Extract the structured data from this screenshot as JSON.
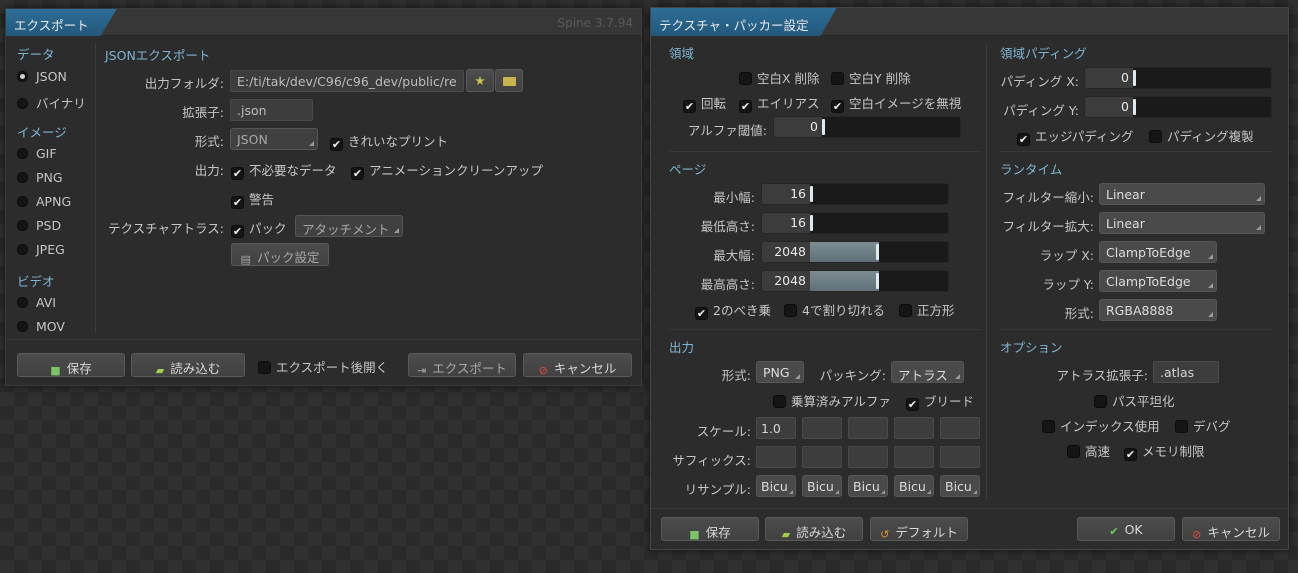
{
  "export_window": {
    "title": "エクスポート",
    "version": "Spine 3.7.94",
    "sidebar": {
      "data_header": "データ",
      "json": "JSON",
      "binary": "バイナリ",
      "image_header": "イメージ",
      "gif": "GIF",
      "png": "PNG",
      "apng": "APNG",
      "psd": "PSD",
      "jpeg": "JPEG",
      "video_header": "ビデオ",
      "avi": "AVI",
      "mov": "MOV",
      "selected": "JSON"
    },
    "main": {
      "section_title": "JSONエクスポート",
      "output_folder_label": "出力フォルダ:",
      "output_folder_value": "E:/ti/tak/dev/C96/c96_dev/public/re",
      "extension_label": "拡張子:",
      "extension_value": ".json",
      "format_label": "形式:",
      "format_value": "JSON",
      "pretty_print": "きれいなプリント",
      "output_label": "出力:",
      "unneeded_data": "不必要なデータ",
      "animation_cleanup": "アニメーションクリーンアップ",
      "warnings": "警告",
      "texture_atlas_label": "テクスチャアトラス:",
      "pack": "パック",
      "attachment_value": "アタッチメント",
      "pack_settings_button": "パック設定"
    },
    "footer": {
      "save": "保存",
      "load": "読み込む",
      "open_after_export": "エクスポート後開く",
      "export": "エクスポート",
      "cancel": "キャンセル"
    }
  },
  "packer_window": {
    "title": "テクスチャ・パッカー設定",
    "regions": {
      "header": "領域",
      "strip_x": "空白X 削除",
      "strip_y": "空白Y 削除",
      "rotation": "回転",
      "alias": "エイリアス",
      "ignore_blank": "空白イメージを無視",
      "alpha_threshold_label": "アルファ閾値:",
      "alpha_threshold_value": "0"
    },
    "region_padding": {
      "header": "領域パディング",
      "padding_x_label": "パディング X:",
      "padding_x_value": "0",
      "padding_y_label": "パディング Y:",
      "padding_y_value": "0",
      "edge_padding": "エッジパディング",
      "duplicate_padding": "パディング複製"
    },
    "pages": {
      "header": "ページ",
      "min_width_label": "最小幅:",
      "min_width_value": "16",
      "min_height_label": "最低高さ:",
      "min_height_value": "16",
      "max_width_label": "最大幅:",
      "max_width_value": "2048",
      "max_height_label": "最高高さ:",
      "max_height_value": "2048",
      "power_of_two": "2のべき乗",
      "divisible_by_4": "4で割り切れる",
      "square": "正方形"
    },
    "runtime": {
      "header": "ランタイム",
      "filter_min_label": "フィルター縮小:",
      "filter_min_value": "Linear",
      "filter_mag_label": "フィルター拡大:",
      "filter_mag_value": "Linear",
      "wrap_x_label": "ラップ X:",
      "wrap_x_value": "ClampToEdge",
      "wrap_y_label": "ラップ Y:",
      "wrap_y_value": "ClampToEdge",
      "format_label": "形式:",
      "format_value": "RGBA8888"
    },
    "output": {
      "header": "出力",
      "format_label": "形式:",
      "format_value": "PNG",
      "packing_label": "パッキング:",
      "packing_value": "アトラス",
      "premultiplied_alpha": "乗算済みアルファ",
      "bleed": "ブリード",
      "scale_label": "スケール:",
      "scale_values": [
        "1.0",
        "",
        "",
        "",
        ""
      ],
      "suffix_label": "サフィックス:",
      "suffix_values": [
        "",
        "",
        "",
        "",
        ""
      ],
      "resample_label": "リサンプル:",
      "resample_values": [
        "Bicu",
        "Bicu",
        "Bicu",
        "Bicu",
        "Bicu"
      ]
    },
    "options": {
      "header": "オプション",
      "atlas_extension_label": "アトラス拡張子:",
      "atlas_extension_value": ".atlas",
      "flatten_paths": "パス平坦化",
      "use_indexes": "インデックス使用",
      "debug": "デバグ",
      "fast": "高速",
      "limit_memory": "メモリ制限"
    },
    "footer": {
      "save": "保存",
      "load": "読み込む",
      "default": "デフォルト",
      "ok": "OK",
      "cancel": "キャンセル"
    },
    "slider_levels": {
      "alpha_threshold": 0,
      "padding_x": 0,
      "padding_y": 0,
      "min_width": 0,
      "min_height": 0,
      "max_width": 0.5,
      "max_height": 0.5
    }
  },
  "colors": {
    "title_accent": "#2d6e98",
    "section_header": "#7fb4d3",
    "window_bg": "#2c2c2c"
  }
}
